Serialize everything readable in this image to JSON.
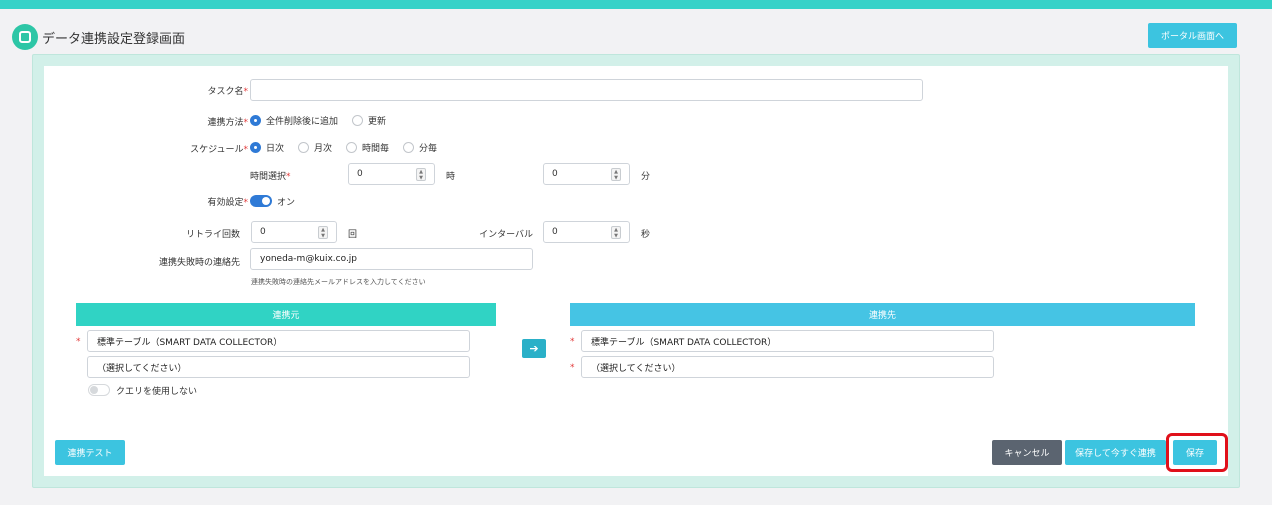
{
  "header": {
    "title": "データ連携設定登録画面",
    "portal_button": "ポータル画面へ"
  },
  "form": {
    "task_name": {
      "label": "タスク名",
      "required": "*",
      "value": ""
    },
    "method": {
      "label": "連携方法",
      "required": "*",
      "options": [
        "全件削除後に追加",
        "更新"
      ],
      "selected": "全件削除後に追加"
    },
    "schedule": {
      "label": "スケジュール",
      "required": "*",
      "options": [
        "日次",
        "月次",
        "時間毎",
        "分毎"
      ],
      "selected": "日次"
    },
    "time_select": {
      "label": "時間選択",
      "required": "*",
      "hour_value": "0",
      "hour_unit": "時",
      "minute_value": "0",
      "minute_unit": "分"
    },
    "enabled": {
      "label": "有効設定",
      "required": "*",
      "state": "オン"
    },
    "retry": {
      "label": "リトライ回数",
      "value": "0",
      "unit": "回"
    },
    "interval": {
      "label": "インターバル",
      "value": "0",
      "unit": "秒"
    },
    "contact": {
      "label": "連携失敗時の連絡先",
      "value": "yoneda-m@kuix.co.jp",
      "hint": "連携失敗時の連絡先メールアドレスを入力してください"
    }
  },
  "source": {
    "title": "連携元",
    "table": "標準テーブル（SMART DATA COLLECTOR）",
    "select": "（選択してください）",
    "query_toggle": "クエリを使用しない",
    "required": "*"
  },
  "destination": {
    "title": "連携先",
    "table": "標準テーブル（SMART DATA COLLECTOR）",
    "select": "（選択してください）",
    "required": "*"
  },
  "footer": {
    "test_button": "連携テスト",
    "cancel_button": "キャンセル",
    "save_run_button": "保存して今すぐ連携",
    "save_button": "保存"
  },
  "colors": {
    "accent": "#36d2c8",
    "primary": "#3cc4e0",
    "highlight": "#e0101a"
  }
}
